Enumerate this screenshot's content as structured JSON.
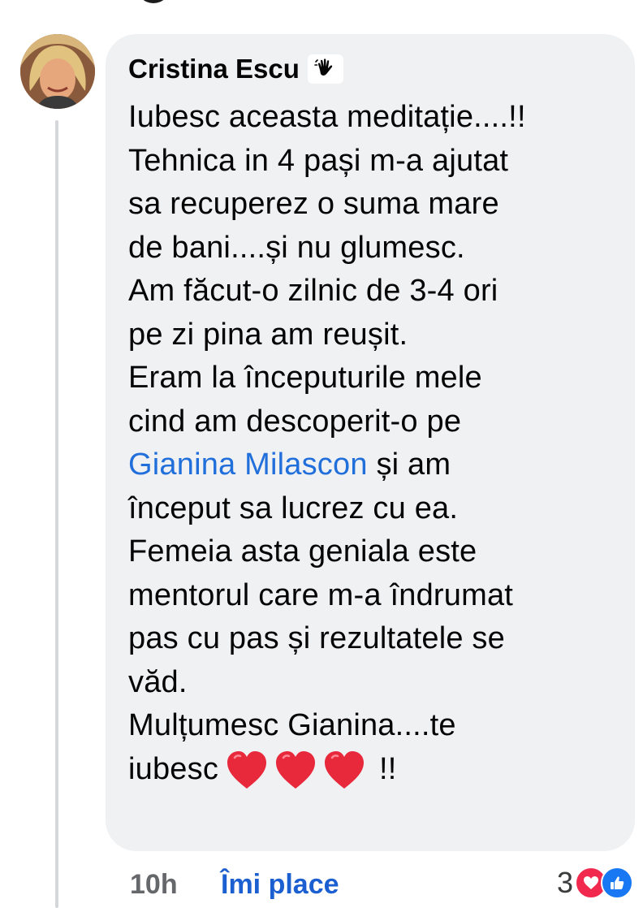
{
  "comment": {
    "author_name": "Cristina Escu",
    "author_badge": "wave-hand-icon",
    "lines_before_mention": [
      "Iubesc aceasta meditație....!!",
      "Tehnica in 4 pași m-a ajutat",
      "sa recuperez o suma mare",
      "de bani....și nu glumesc.",
      "Am făcut-o zilnic de 3-4 ori",
      "pe zi pina am reușit.",
      "Eram la începuturile mele",
      "cind am descoperit-o pe"
    ],
    "mention": "Gianina Milascon",
    "mention_suffix": " și am",
    "lines_after_mention": [
      "început sa lucrez cu ea.",
      "Femeia asta geniala este",
      "mentorul care m-a îndrumat",
      "pas cu pas și rezultatele se",
      "văd.",
      "Mulțumesc Gianina....te"
    ],
    "last_line_prefix": "iubesc",
    "last_line_suffix": "!!",
    "hearts": [
      "heart-icon",
      "heart-icon",
      "heart-icon"
    ]
  },
  "footer": {
    "time": "10h",
    "like_label": "Îmi place",
    "reaction_count": "3",
    "reaction_icons": [
      "love-reaction-icon",
      "like-reaction-icon"
    ]
  },
  "colors": {
    "bubble": "#f0f1f3",
    "mention": "#216fdb",
    "like_link": "#1b5fd0",
    "heart": "#e8283b"
  }
}
